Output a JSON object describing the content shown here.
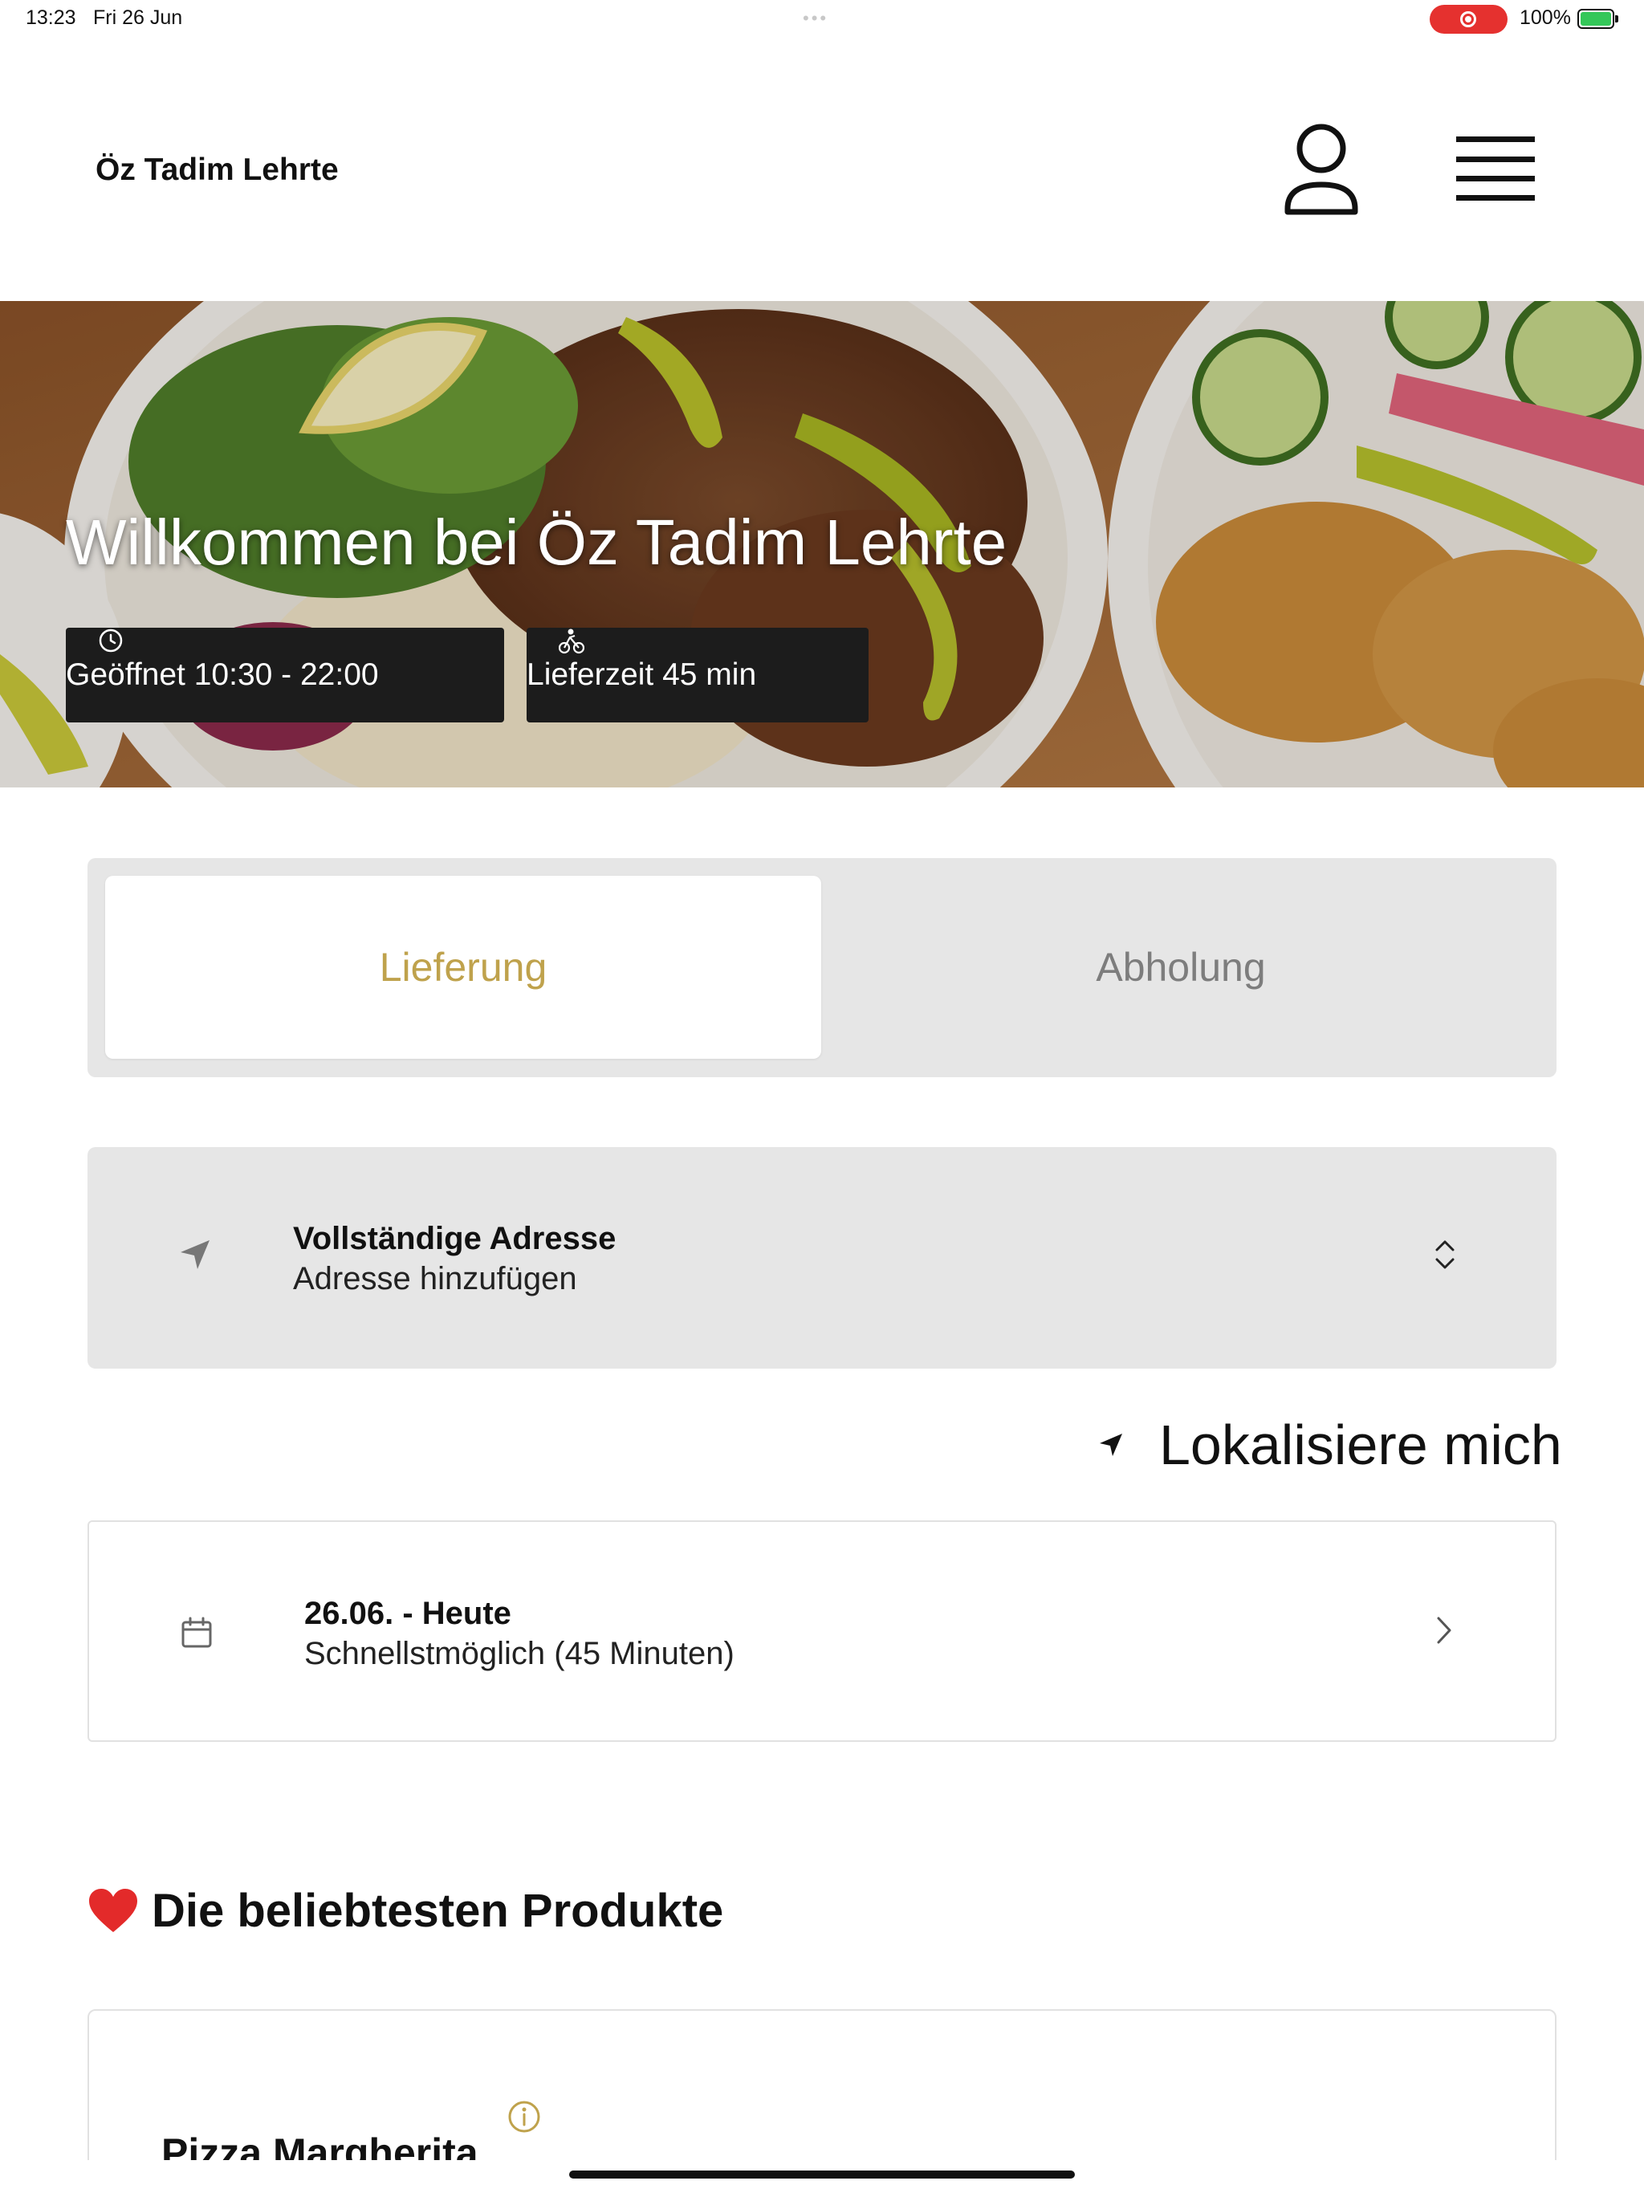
{
  "status_bar": {
    "time": "13:23",
    "date": "Fri 26 Jun",
    "battery": "100%"
  },
  "header": {
    "brand": "Öz Tadim Lehrte",
    "icons": [
      "user-icon",
      "menu-icon"
    ]
  },
  "hero": {
    "title": "Willkommen bei Öz Tadim Lehrte",
    "opening_hours": "Geöffnet 10:30 - 22:00",
    "delivery_time": "Lieferzeit 45 min"
  },
  "order_mode": {
    "tabs": [
      {
        "label": "Lieferung",
        "active": true
      },
      {
        "label": "Abholung",
        "active": false
      }
    ],
    "active_color": "#bfa24c"
  },
  "address": {
    "label": "Vollständige Adresse",
    "value": "Adresse hinzufügen"
  },
  "locate": {
    "label": "Lokalisiere mich"
  },
  "schedule": {
    "date": "26.06. - Heute",
    "time": "Schnellstmöglich (45 Minuten)"
  },
  "popular": {
    "title": "Die beliebtesten Produkte",
    "products": [
      {
        "name": "Pizza Margherita"
      }
    ]
  }
}
